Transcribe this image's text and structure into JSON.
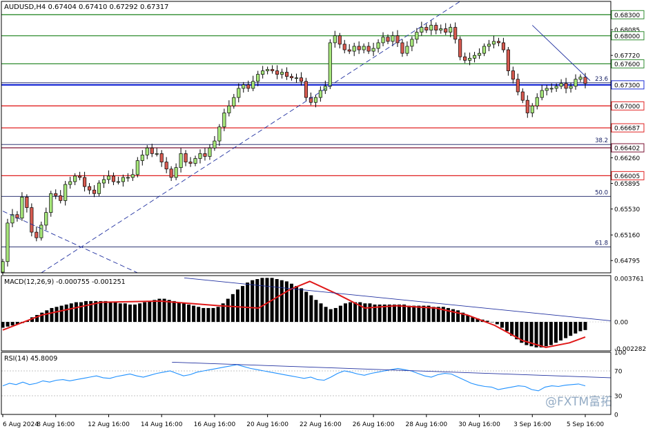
{
  "chart_data": [
    {
      "type": "candlestick",
      "header": "AUDUSD,H4  0.67404 0.67410 0.67292 0.67317",
      "symbol": "AUDUSD,H4",
      "ylim": [
        0.6462,
        0.6849
      ],
      "y_ticks": [
        "0.68300",
        "0.68085",
        "0.68000",
        "0.67720",
        "0.67600",
        "0.67300",
        "0.67000",
        "0.66687",
        "0.66402",
        "0.66260",
        "0.66005",
        "0.65895",
        "0.65530",
        "0.65160",
        "0.64795"
      ],
      "horizontal_levels": [
        {
          "price": 0.683,
          "color": "#2e8b2e",
          "tag": "0.68300"
        },
        {
          "price": 0.68,
          "color": "#2e8b2e",
          "tag": "0.68000"
        },
        {
          "price": 0.676,
          "color": "#2e8b2e",
          "tag": "0.67600"
        },
        {
          "price": 0.673,
          "color": "#1a2bd6",
          "tag": "0.67300"
        },
        {
          "price": 0.67,
          "color": "#e02020",
          "tag": "0.67000"
        },
        {
          "price": 0.66687,
          "color": "#e02020",
          "tag": "0.66687"
        },
        {
          "price": 0.66402,
          "color": "#7a1030",
          "tag": "0.66402"
        },
        {
          "price": 0.66005,
          "color": "#e02020",
          "tag": "0.66005"
        }
      ],
      "fibonacci_levels": [
        {
          "label": "23.6",
          "price": 0.6733
        },
        {
          "label": "38.2",
          "price": 0.6645
        },
        {
          "label": "50.0",
          "price": 0.6571
        },
        {
          "label": "61.8",
          "price": 0.6499
        }
      ],
      "candles": [
        0.6478,
        0.6533,
        0.6545,
        0.654,
        0.657,
        0.6555,
        0.652,
        0.6512,
        0.653,
        0.6548,
        0.6575,
        0.6572,
        0.6565,
        0.6588,
        0.6592,
        0.66,
        0.6598,
        0.6585,
        0.658,
        0.6575,
        0.659,
        0.6595,
        0.66,
        0.6592,
        0.6592,
        0.6598,
        0.6598,
        0.6602,
        0.6622,
        0.663,
        0.664,
        0.6632,
        0.6632,
        0.662,
        0.661,
        0.6598,
        0.6612,
        0.6632,
        0.662,
        0.6618,
        0.6625,
        0.6632,
        0.6628,
        0.664,
        0.665,
        0.667,
        0.669,
        0.67,
        0.6712,
        0.6725,
        0.673,
        0.6725,
        0.6735,
        0.6745,
        0.675,
        0.6752,
        0.675,
        0.6745,
        0.6748,
        0.6742,
        0.674,
        0.674,
        0.6735,
        0.6712,
        0.6705,
        0.6712,
        0.6722,
        0.6728,
        0.679,
        0.68,
        0.6788,
        0.678,
        0.6778,
        0.6785,
        0.678,
        0.6785,
        0.6778,
        0.6782,
        0.679,
        0.6798,
        0.6792,
        0.68,
        0.679,
        0.6775,
        0.6785,
        0.6795,
        0.6805,
        0.6812,
        0.6808,
        0.6815,
        0.6808,
        0.681,
        0.6805,
        0.6812,
        0.6795,
        0.677,
        0.6765,
        0.6768,
        0.6772,
        0.6775,
        0.6785,
        0.6788,
        0.6792,
        0.679,
        0.678,
        0.675,
        0.6738,
        0.672,
        0.6708,
        0.669,
        0.67,
        0.6712,
        0.6722,
        0.6725,
        0.6725,
        0.6728,
        0.6732,
        0.6725,
        0.6728,
        0.6738,
        0.6741,
        0.6732
      ],
      "trendlines": [
        {
          "style": "solid",
          "from": [
            110,
            0.6815
          ],
          "to": [
            122,
            0.6736
          ]
        },
        {
          "style": "dashed",
          "from": [
            8,
            0.6462
          ],
          "to": [
            95,
            0.6849
          ]
        },
        {
          "style": "dashed",
          "from": [
            0,
            0.655
          ],
          "to": [
            28,
            0.6462
          ]
        }
      ]
    },
    {
      "type": "histogram",
      "label": "MACD(12,26,9) -0.000755 -0.001251",
      "ylim": [
        -0.0025,
        0.004
      ],
      "y_ticks": [
        "0.003761",
        "0.00",
        "-0.002282"
      ],
      "values": [
        -0.0005,
        -0.0004,
        -0.0003,
        -0.0002,
        -0.0001,
        0.0001,
        0.0004,
        0.0006,
        0.0008,
        0.001,
        0.0012,
        0.0013,
        0.0014,
        0.0015,
        0.0016,
        0.0017,
        0.0017,
        0.0018,
        0.0018,
        0.0018,
        0.0018,
        0.0018,
        0.0017,
        0.0017,
        0.0016,
        0.0016,
        0.0015,
        0.0015,
        0.0016,
        0.0017,
        0.0018,
        0.0019,
        0.002,
        0.002,
        0.0019,
        0.0018,
        0.0017,
        0.0016,
        0.0015,
        0.0014,
        0.0013,
        0.0012,
        0.0012,
        0.0012,
        0.0013,
        0.0016,
        0.002,
        0.0024,
        0.0028,
        0.0031,
        0.0034,
        0.0036,
        0.0037,
        0.0038,
        0.0038,
        0.0038,
        0.0037,
        0.0036,
        0.0035,
        0.0033,
        0.0031,
        0.0029,
        0.0026,
        0.0023,
        0.0019,
        0.0016,
        0.0013,
        0.0011,
        0.0012,
        0.0014,
        0.0016,
        0.0017,
        0.0017,
        0.0017,
        0.0016,
        0.0016,
        0.0015,
        0.0015,
        0.0015,
        0.0015,
        0.0015,
        0.0015,
        0.0015,
        0.0014,
        0.0014,
        0.0014,
        0.0014,
        0.0014,
        0.0013,
        0.0013,
        0.0013,
        0.0012,
        0.0011,
        0.001,
        0.0008,
        0.0006,
        0.0004,
        0.0003,
        0.0002,
        0.0001,
        0.0,
        -0.0002,
        -0.0005,
        -0.0008,
        -0.0012,
        -0.0015,
        -0.0018,
        -0.002,
        -0.0021,
        -0.0022,
        -0.0022,
        -0.0021,
        -0.002,
        -0.0018,
        -0.0016,
        -0.0014,
        -0.0012,
        -0.001,
        -0.0008,
        -0.0007
      ],
      "signal": [
        [
          0,
          -0.0007
        ],
        [
          10,
          0.0006
        ],
        [
          25,
          0.0017
        ],
        [
          40,
          0.0018
        ],
        [
          55,
          0.0014
        ],
        [
          65,
          0.0012
        ],
        [
          73,
          0.0028
        ],
        [
          78,
          0.0035
        ],
        [
          85,
          0.0024
        ],
        [
          92,
          0.0012
        ],
        [
          100,
          0.0014
        ],
        [
          110,
          0.0012
        ],
        [
          118,
          0.0006
        ],
        [
          125,
          -0.0003
        ],
        [
          132,
          -0.0016
        ],
        [
          138,
          -0.0022
        ],
        [
          144,
          -0.0018
        ],
        [
          148,
          -0.0013
        ]
      ],
      "trendline": {
        "from": [
          0.3,
          0.0038
        ],
        "to": [
          1.0,
          0.0001
        ]
      }
    },
    {
      "type": "line",
      "label": "RSI(14) 45.8009",
      "ylim": [
        0,
        100
      ],
      "y_ticks": [
        "100",
        "70",
        "30",
        "0"
      ],
      "values": [
        46,
        50,
        48,
        52,
        48,
        50,
        54,
        52,
        55,
        56,
        54,
        56,
        58,
        60,
        62,
        59,
        58,
        61,
        63,
        65,
        62,
        60,
        63,
        66,
        68,
        70,
        66,
        62,
        64,
        68,
        70,
        72,
        74,
        76,
        78,
        80,
        77,
        74,
        72,
        70,
        68,
        66,
        64,
        62,
        60,
        58,
        60,
        56,
        55,
        60,
        66,
        70,
        68,
        65,
        63,
        66,
        68,
        70,
        72,
        74,
        72,
        70,
        66,
        62,
        60,
        64,
        66,
        65,
        60,
        55,
        50,
        47,
        45,
        44,
        40,
        42,
        44,
        46,
        45,
        40,
        38,
        44,
        46,
        45,
        47,
        48,
        49,
        46
      ],
      "trendline": {
        "from": [
          0.28,
          84
        ],
        "to": [
          1.0,
          59
        ]
      }
    }
  ],
  "time_axis": [
    "6 Aug 2024",
    "8 Aug 16:00",
    "12 Aug 16:00",
    "14 Aug 16:00",
    "16 Aug 16:00",
    "20 Aug 16:00",
    "22 Aug 16:00",
    "26 Aug 16:00",
    "28 Aug 16:00",
    "30 Aug 16:00",
    "3 Sep 16:00",
    "5 Sep 16:00"
  ],
  "watermark": "@FXTM富拓"
}
